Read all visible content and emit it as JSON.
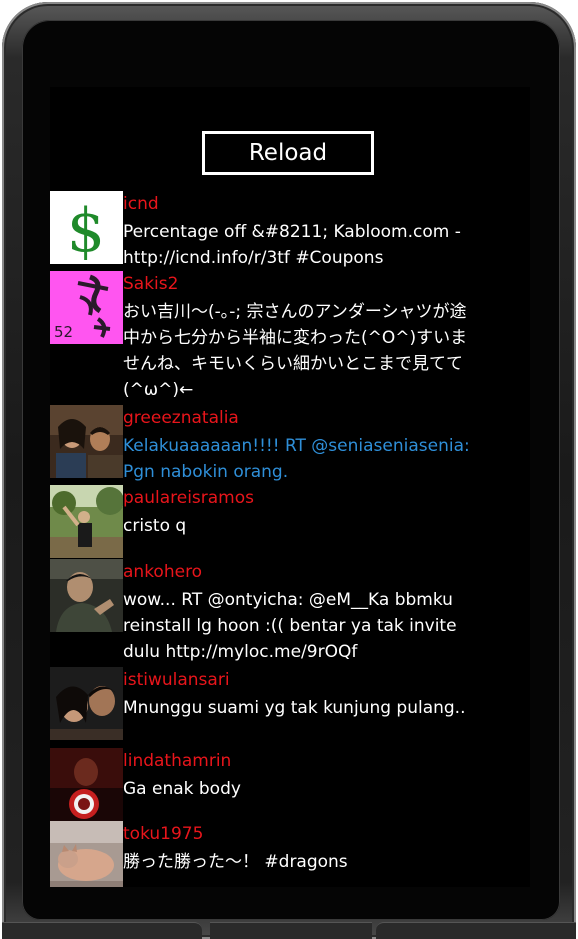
{
  "app": {
    "reload_label": "Reload"
  },
  "tweets": [
    {
      "user": "icnd",
      "text": "Percentage off &#8211; Kabloom.com - http://icnd.info/r/3tf #Coupons",
      "highlight": false,
      "avatar": "dollar-sign-avatar"
    },
    {
      "user": "Sakis2",
      "text": "おい吉川〜(-｡-; 宗さんのアンダーシャツが途中から七分から半袖に変わった(^O^)すいませんね、キモいくらい細かいとこまで見てて(^ω^)←",
      "highlight": false,
      "avatar": "pink-calligraphy-avatar"
    },
    {
      "user": "greeeznatalia",
      "text": "Kelakuaaaaaan!!!! RT @seniaseniasenia: Pgn nabokin orang.",
      "highlight": true,
      "avatar": "couple-photo-avatar"
    },
    {
      "user": "paulareisramos",
      "text": "cristo q",
      "highlight": false,
      "avatar": "outdoor-photo-avatar"
    },
    {
      "user": "ankohero",
      "text": "wow... RT @ontyicha: @eM__Ka bbmku reinstall lg hoon :(( bentar ya tak invite dulu http://myloc.me/9rOQf",
      "highlight": false,
      "avatar": "dark-person-avatar"
    },
    {
      "user": "istiwulansari",
      "text": "Mnunggu suami yg tak kunjung pulang..",
      "highlight": false,
      "avatar": "couple-selfie-avatar"
    },
    {
      "user": "lindathamrin",
      "text": "Ga enak body",
      "highlight": false,
      "avatar": "red-portrait-avatar"
    },
    {
      "user": "toku1975",
      "text": "勝った勝った〜！ #dragons",
      "highlight": false,
      "avatar": "cat-photo-avatar"
    }
  ],
  "colors": {
    "username": "#e8151b",
    "text": "#ffffff",
    "highlight_text": "#2f8fd8",
    "screen": "#000000"
  }
}
